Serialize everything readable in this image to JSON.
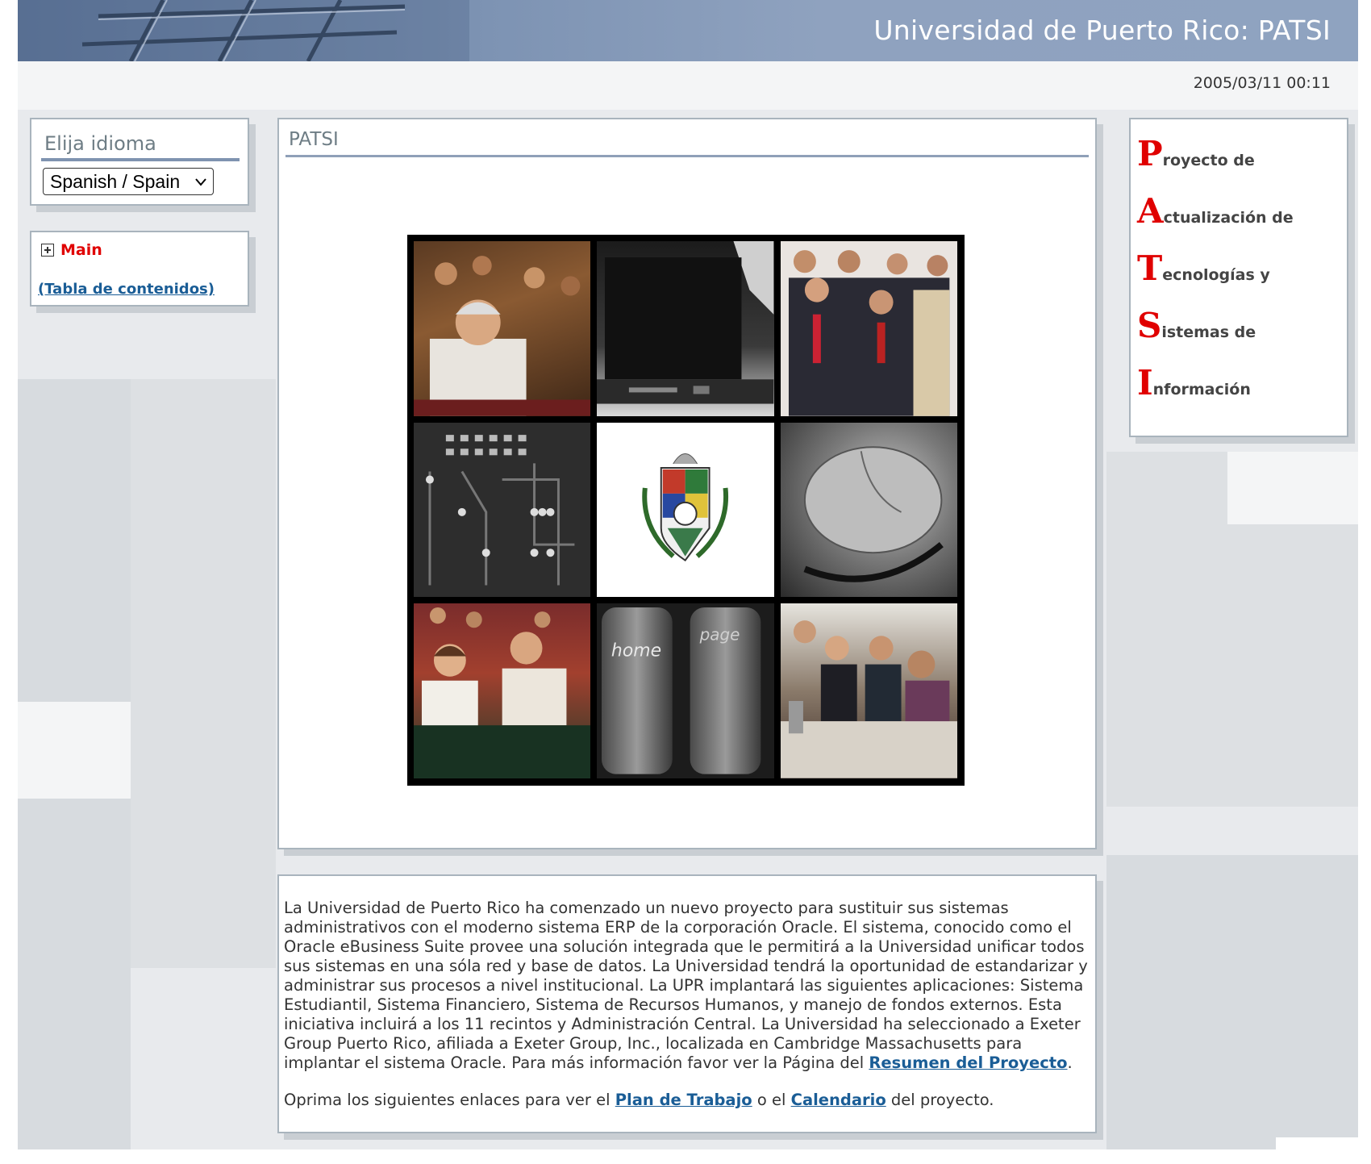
{
  "header": {
    "title": "Universidad de Puerto Rico: PATSI",
    "date": "2005/03/11 00:11"
  },
  "language": {
    "heading": "Elija idioma",
    "selected": "Spanish / Spain"
  },
  "nav": {
    "main_label": "Main",
    "toc_label": "(Tabla de contenidos)"
  },
  "content": {
    "title": "PATSI",
    "collage": {
      "tiles": [
        "people-audience-photo",
        "laptop-photo",
        "group-portrait-photo",
        "circuit-board-photo",
        "university-crest",
        "computer-mouse-photo",
        "conference-photo",
        "keyboard-keys-photo",
        "meeting-table-photo"
      ],
      "key_label_home": "home",
      "key_label_page": "page"
    }
  },
  "description": {
    "paragraph_pre": "La Universidad de Puerto Rico ha comenzado un nuevo proyecto para sustituir sus sistemas administrativos con el moderno sistema ERP de la corporación Oracle. El sistema, conocido como el Oracle eBusiness Suite provee una solución integrada que le permitirá a la Universidad unificar todos sus sistemas en una sóla red y base de datos. La Universidad tendrá la oportunidad de estandarizar y administrar sus procesos a nivel institucional. La UPR implantará las siguientes aplicaciones: Sistema Estudiantil, Sistema Financiero, Sistema de Recursos Humanos, y manejo de fondos externos. Esta iniciativa incluirá a los 11 recintos y Administración Central. La Universidad ha seleccionado a Exeter Group Puerto Rico, afiliada a Exeter Group, Inc., localizada en Cambridge Massachusetts para implantar el sistema Oracle. Para más información favor ver la Página del ",
    "summary_link": "Resumen del Proyecto",
    "paragraph_post": ".",
    "links_pre": "Oprima los siguientes enlaces para ver el ",
    "plan_link": "Plan de Trabajo",
    "links_mid": " o el ",
    "calendar_link": "Calendario",
    "links_post": " del proyecto."
  },
  "acronym": [
    {
      "letter": "P",
      "rest": "royecto de"
    },
    {
      "letter": "A",
      "rest": "ctualización de"
    },
    {
      "letter": "T",
      "rest": "ecnologías y"
    },
    {
      "letter": "S",
      "rest": "istemas de"
    },
    {
      "letter": "I",
      "rest": "nformación"
    }
  ],
  "colors": {
    "header_blue": "#7d93b3",
    "link_blue": "#1a5d96",
    "accent_red": "#e00000"
  }
}
